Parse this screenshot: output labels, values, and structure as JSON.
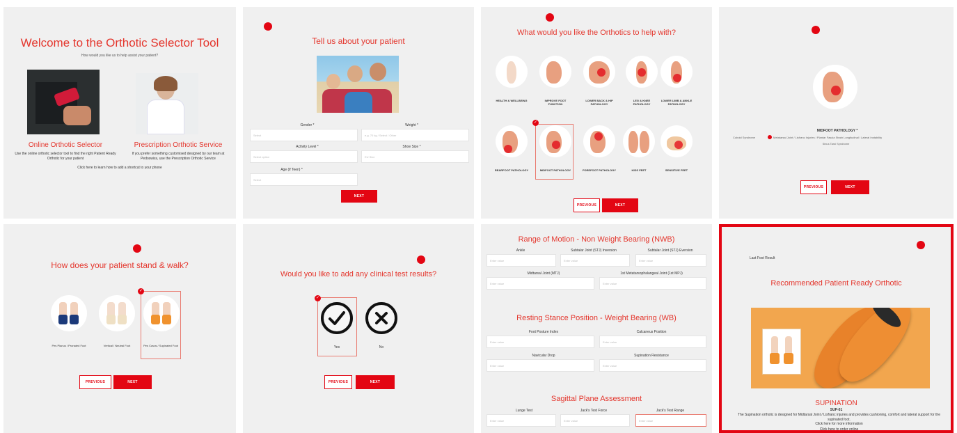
{
  "welcome": {
    "title": "Welcome to the Orthotic Selector Tool",
    "subtitle": "How would you like us to help assist your patient?",
    "online_title": "Online Orthotic Selector",
    "online_desc": "Use the online orthotic selector tool to find the right Patient Ready Orthotic for your patient",
    "prescription_title": "Prescription Orthotic Service",
    "prescription_desc": "If you prefer something customised designed by our team at Pedoswiss, use the Prescription Orthotic Service",
    "shortcut_link": "Click here to learn how to add a shortcut to your phone"
  },
  "patient": {
    "title": "Tell us about your patient",
    "gender_label": "Gender *",
    "weight_label": "Weight *",
    "activity_label": "Activity Level *",
    "shoe_label": "Shoe Size *",
    "age_label": "Age (if Teen) *",
    "gender_placeholder": "Select",
    "weight_placeholder": "e.g. 70 kg / Select / Other",
    "activity_placeholder": "Select option",
    "shoe_placeholder": "EU Size",
    "age_placeholder": "Select",
    "next": "NEXT"
  },
  "help": {
    "title": "What would you like the Orthotics to help with?",
    "items": [
      "HEALTH & WELLBEING",
      "IMPROVE FOOT FUNCTION",
      "LOWER BACK & HIP PATHOLOGY",
      "LEG & KNEE PATHOLOGY",
      "LOWER LIMB & ANKLE PATHOLOGY",
      "REARFOOT PATHOLOGY",
      "MIDFOOT PATHOLOGY",
      "FOREFOOT PATHOLOGY",
      "KIDS FEET",
      "SENSITIVE FEET"
    ],
    "previous": "PREVIOUS",
    "next": "NEXT"
  },
  "midfoot": {
    "label": "MIDFOOT PATHOLOGY *",
    "options_left": "Cuboid Syndrome",
    "options_right": "Metatarsal Joint / Lisfranc Injuries / Plantar Fascia Strain Longitudinal / Lateral Instability",
    "options_bottom": "Sinus Tarsi Syndrome",
    "previous": "PREVIOUS",
    "next": "NEXT"
  },
  "stand": {
    "title": "How does your patient stand & walk?",
    "options": [
      "Pes Planus / Pronated Foot",
      "Vertical / Neutral Foot",
      "Pes Cavus / Supinated Foot"
    ],
    "previous": "PREVIOUS",
    "next": "NEXT"
  },
  "clinical": {
    "title": "Would you like to add any clinical test results?",
    "yes": "Yes",
    "no": "No",
    "previous": "PREVIOUS",
    "next": "NEXT"
  },
  "motion": {
    "nwb_title": "Range of Motion - Non Weight Bearing (NWB)",
    "ankle": "Ankle",
    "stj_inv": "Subtalar Joint (STJ) Inversion",
    "stj_ev": "Subtalar Joint (STJ) Eversion",
    "mtj": "Midtarsal Joint (MTJ)",
    "mtpj": "1st Metatarsophalangeal Joint (1st MPJ)",
    "wb_title": "Resting Stance Position - Weight Bearing (WB)",
    "fpi": "Foot Posture Index",
    "calc": "Calcaneus Position",
    "navicular": "Navicular Drop",
    "supination": "Supination Resistance",
    "sag_title": "Sagittal Plane Assessment",
    "lunge": "Lunge Test",
    "jack_force": "Jack's Test Force",
    "jack_range": "Jack's Test Range",
    "placeholder": "Enter value"
  },
  "result": {
    "top_note": "Last Foot Result",
    "title": "Recommended Patient Ready Orthotic",
    "name": "SUPINATION",
    "code": "SUP-01",
    "desc": "The Supination orthotic is designed for Midtarsal Joint / Lisfranc injuries and provides cushioning, comfort and lateral support for the supinated foot.",
    "more_link": "Click here for more information",
    "order_link": "Click here to order online"
  },
  "colors": {
    "accent": "#e30613",
    "title_red": "#e4362d",
    "panel_bg": "#f0f0f0",
    "orthotic_orange": "#f2a64e"
  }
}
